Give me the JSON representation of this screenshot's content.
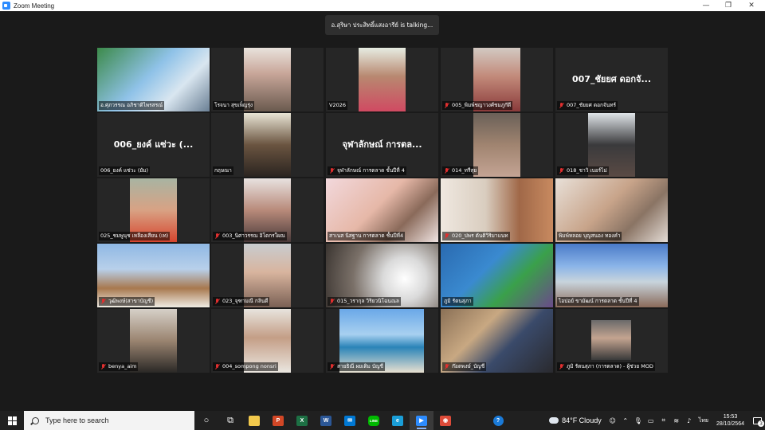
{
  "window": {
    "title": "Zoom Meeting",
    "minimize": "—",
    "maximize": "❐",
    "close": "✕"
  },
  "talking": "อ.สุริษา ประสิทธิ์แสงอารีย์ is talking...",
  "colors": {
    "accent": "#2d8cff",
    "active_border": "#7ad13b",
    "muted_mic": "#e02f2f"
  },
  "tiles": [
    {
      "label": "อ.ศุภวรรณ อภิชาติไพรสรณ์",
      "muted": false,
      "video": true,
      "bg": "linear-gradient(135deg,#3c8a4a 0%,#8fc2e8 45%,#d9e6f0 70%,#6a7f94 100%)",
      "full": true,
      "active": true
    },
    {
      "label": "โรจนา สุขเพ็ญรุ่ง",
      "muted": false,
      "video": true,
      "bg": "linear-gradient(180deg,#e8e2dc 0%,#c9a79a 40%,#6a5a4e 100%)",
      "full": false
    },
    {
      "label": "V2026",
      "muted": false,
      "video": true,
      "bg": "linear-gradient(180deg,#e6ece2 0%,#b88870 45%,#d04a62 100%)",
      "full": false
    },
    {
      "label": "005_พิมพ์ชญาวงศ์ชมภูก๊ดี",
      "muted": true,
      "video": true,
      "bg": "linear-gradient(180deg,#d2c9c2 0%,#c28a7a 45%,#8a3a3a 100%)",
      "full": false
    },
    {
      "label": "007_ชัยยศ ดอกจันทร์",
      "muted": true,
      "video": false,
      "display": "007_ชัยยศ ดอกจั..."
    },
    {
      "label": "006_ยงค์ แซ่วะ (ยัม)",
      "muted": false,
      "video": false,
      "display": "006_ยงค์ แซ่วะ (..."
    },
    {
      "label": "กฤษณา",
      "muted": false,
      "video": true,
      "bg": "linear-gradient(180deg,#e8e4d4 0%,#6a5440 50%,#2a2420 100%)",
      "full": false
    },
    {
      "label": "จุฬาลักษณ์ การตลาด ชั้นปีที่ 4",
      "muted": true,
      "video": false,
      "display": "จุฬาลักษณ์ การตล..."
    },
    {
      "label": "014_ทรีสุย",
      "muted": true,
      "video": true,
      "bg": "linear-gradient(180deg,#6a6058 0%,#a08470 50%,#c4a494 100%)",
      "full": false
    },
    {
      "label": "018_ชาวิ เบอร์ไม่",
      "muted": true,
      "video": true,
      "bg": "linear-gradient(180deg,#dfe4e8 0%,#3a3a3c 50%,#5a4a44 100%)",
      "full": false
    },
    {
      "label": "025_ชมพูนุช เหลืองเสียน (เท)",
      "muted": false,
      "video": true,
      "bg": "linear-gradient(180deg,#a8b4a2 0%,#d8a284 50%,#d6452e 100%)",
      "full": false
    },
    {
      "label": "003_นิศาวรรณ อิโดกรใผณ",
      "muted": true,
      "video": true,
      "bg": "linear-gradient(180deg,#e8e2e0 0%,#b88a7a 50%,#4a3a3a 100%)",
      "full": false
    },
    {
      "label": "สาเนส นิสฐาน การตลาด ชั้นปีที่4",
      "muted": false,
      "video": true,
      "bg": "linear-gradient(135deg,#f2d8dc 0%,#e6b8a8 45%,#8a6a5a 70%,#f0e4e2 100%)",
      "full": true
    },
    {
      "label": "020_ปพร ตันติวิริมาแนท",
      "muted": true,
      "video": true,
      "bg": "linear-gradient(90deg,#efe8e0 0%,#d9cdbf 40%,#a06848 70%,#c88a60 100%)",
      "full": true
    },
    {
      "label": "พิมพ์หลอย บุญสนอง ทองคำ",
      "muted": false,
      "video": true,
      "bg": "linear-gradient(135deg,#e8e0d8 0%,#c8a48a 45%,#8a7464 70%,#e4dcd6 100%)",
      "full": true
    },
    {
      "label": "วุฒิพงษ์(สาขาบัญชี)",
      "muted": true,
      "video": true,
      "bg": "linear-gradient(180deg,#8fb8e4 0%,#b8d0ea 40%,#a8784e 70%,#f0ece4 100%)",
      "full": true
    },
    {
      "label": "023_จุฑามณี กลินดี",
      "muted": true,
      "video": true,
      "bg": "linear-gradient(180deg,#c8ccd0 0%,#d8b49e 45%,#7a6054 100%)",
      "full": false
    },
    {
      "label": "015_วรากุล วิริยวนิโฉนณล",
      "muted": true,
      "video": true,
      "bg": "radial-gradient(circle at 70% 55%,#ffffff 0%,#dadada 25%,#7a7068 60%,#3a3430 100%)",
      "full": true
    },
    {
      "label": "ภูมิ รัตนสุภา",
      "muted": false,
      "video": true,
      "bg": "linear-gradient(135deg,#2a6ab0 0%,#3a8ad0 40%,#3aa04a 65%,#6a4a8a 100%)",
      "full": true
    },
    {
      "label": "ไอปอย์ ขามัฒน์ การตลาด ชั้นปีที่ 4",
      "muted": false,
      "video": true,
      "bg": "linear-gradient(180deg,#4a7ac8 0%,#8ab4e8 35%,#c8d4dc 60%,#8a6a5a 100%)",
      "full": true
    },
    {
      "label": "benya_aim",
      "muted": true,
      "video": true,
      "bg": "linear-gradient(180deg,#d6d0c8 0%,#9a8470 50%,#2a2826 100%)",
      "full": false
    },
    {
      "label": "004_sompong nonsri",
      "muted": true,
      "video": true,
      "bg": "linear-gradient(180deg,#e8e4de 0%,#c49e86 45%,#eae6e0 100%)",
      "full": false
    },
    {
      "label": "สายธิณี ผยเติม บัญชี",
      "muted": true,
      "video": true,
      "bg": "linear-gradient(180deg,#6aa8e8 0%,#a8d0f0 40%,#2a84b8 60%,#e8e0d0 100%)",
      "full": false,
      "wide": true
    },
    {
      "label": "ก๊อตพงษ์_บัญชี",
      "muted": true,
      "video": true,
      "bg": "linear-gradient(135deg,#8a7056 0%,#c8a882 35%,#3a4a6a 60%,#2a2a2e 100%)",
      "full": true
    },
    {
      "label": "ภูมิ รัตนสุภา (การตลาด) - ผู้ช่วย MOD",
      "muted": true,
      "video": true,
      "bg": "linear-gradient(180deg,#6a6a6a 0%,#c4a490 45%,#3a3a3a 100%)",
      "full": false,
      "small": true
    }
  ],
  "taskbar": {
    "search_placeholder": "Type here to search",
    "apps": [
      {
        "name": "cortana-icon",
        "glyph": "○",
        "color": "transparent"
      },
      {
        "name": "task-view-icon",
        "glyph": "⧉",
        "color": "transparent"
      },
      {
        "name": "file-explorer-icon",
        "glyph": "",
        "color": "#f2c94c"
      },
      {
        "name": "powerpoint-icon",
        "glyph": "P",
        "color": "#d24726"
      },
      {
        "name": "excel-icon",
        "glyph": "X",
        "color": "#1d7044"
      },
      {
        "name": "word-icon",
        "glyph": "W",
        "color": "#2b5797"
      },
      {
        "name": "mail-icon",
        "glyph": "✉",
        "color": "#0078d4"
      },
      {
        "name": "line-icon",
        "glyph": "LINE",
        "color": "#00b900"
      },
      {
        "name": "edge-icon",
        "glyph": "e",
        "color": "#1a9ed8"
      },
      {
        "name": "zoom-icon",
        "glyph": "▶",
        "color": "#2d8cff"
      },
      {
        "name": "chrome-icon",
        "glyph": "◉",
        "color": "#dd4b39"
      }
    ],
    "help_glyph": "?",
    "weather": "84°F  Cloudy",
    "lang": "ไทย",
    "time": "15:53",
    "date": "28/10/2564",
    "notifications": "3"
  }
}
